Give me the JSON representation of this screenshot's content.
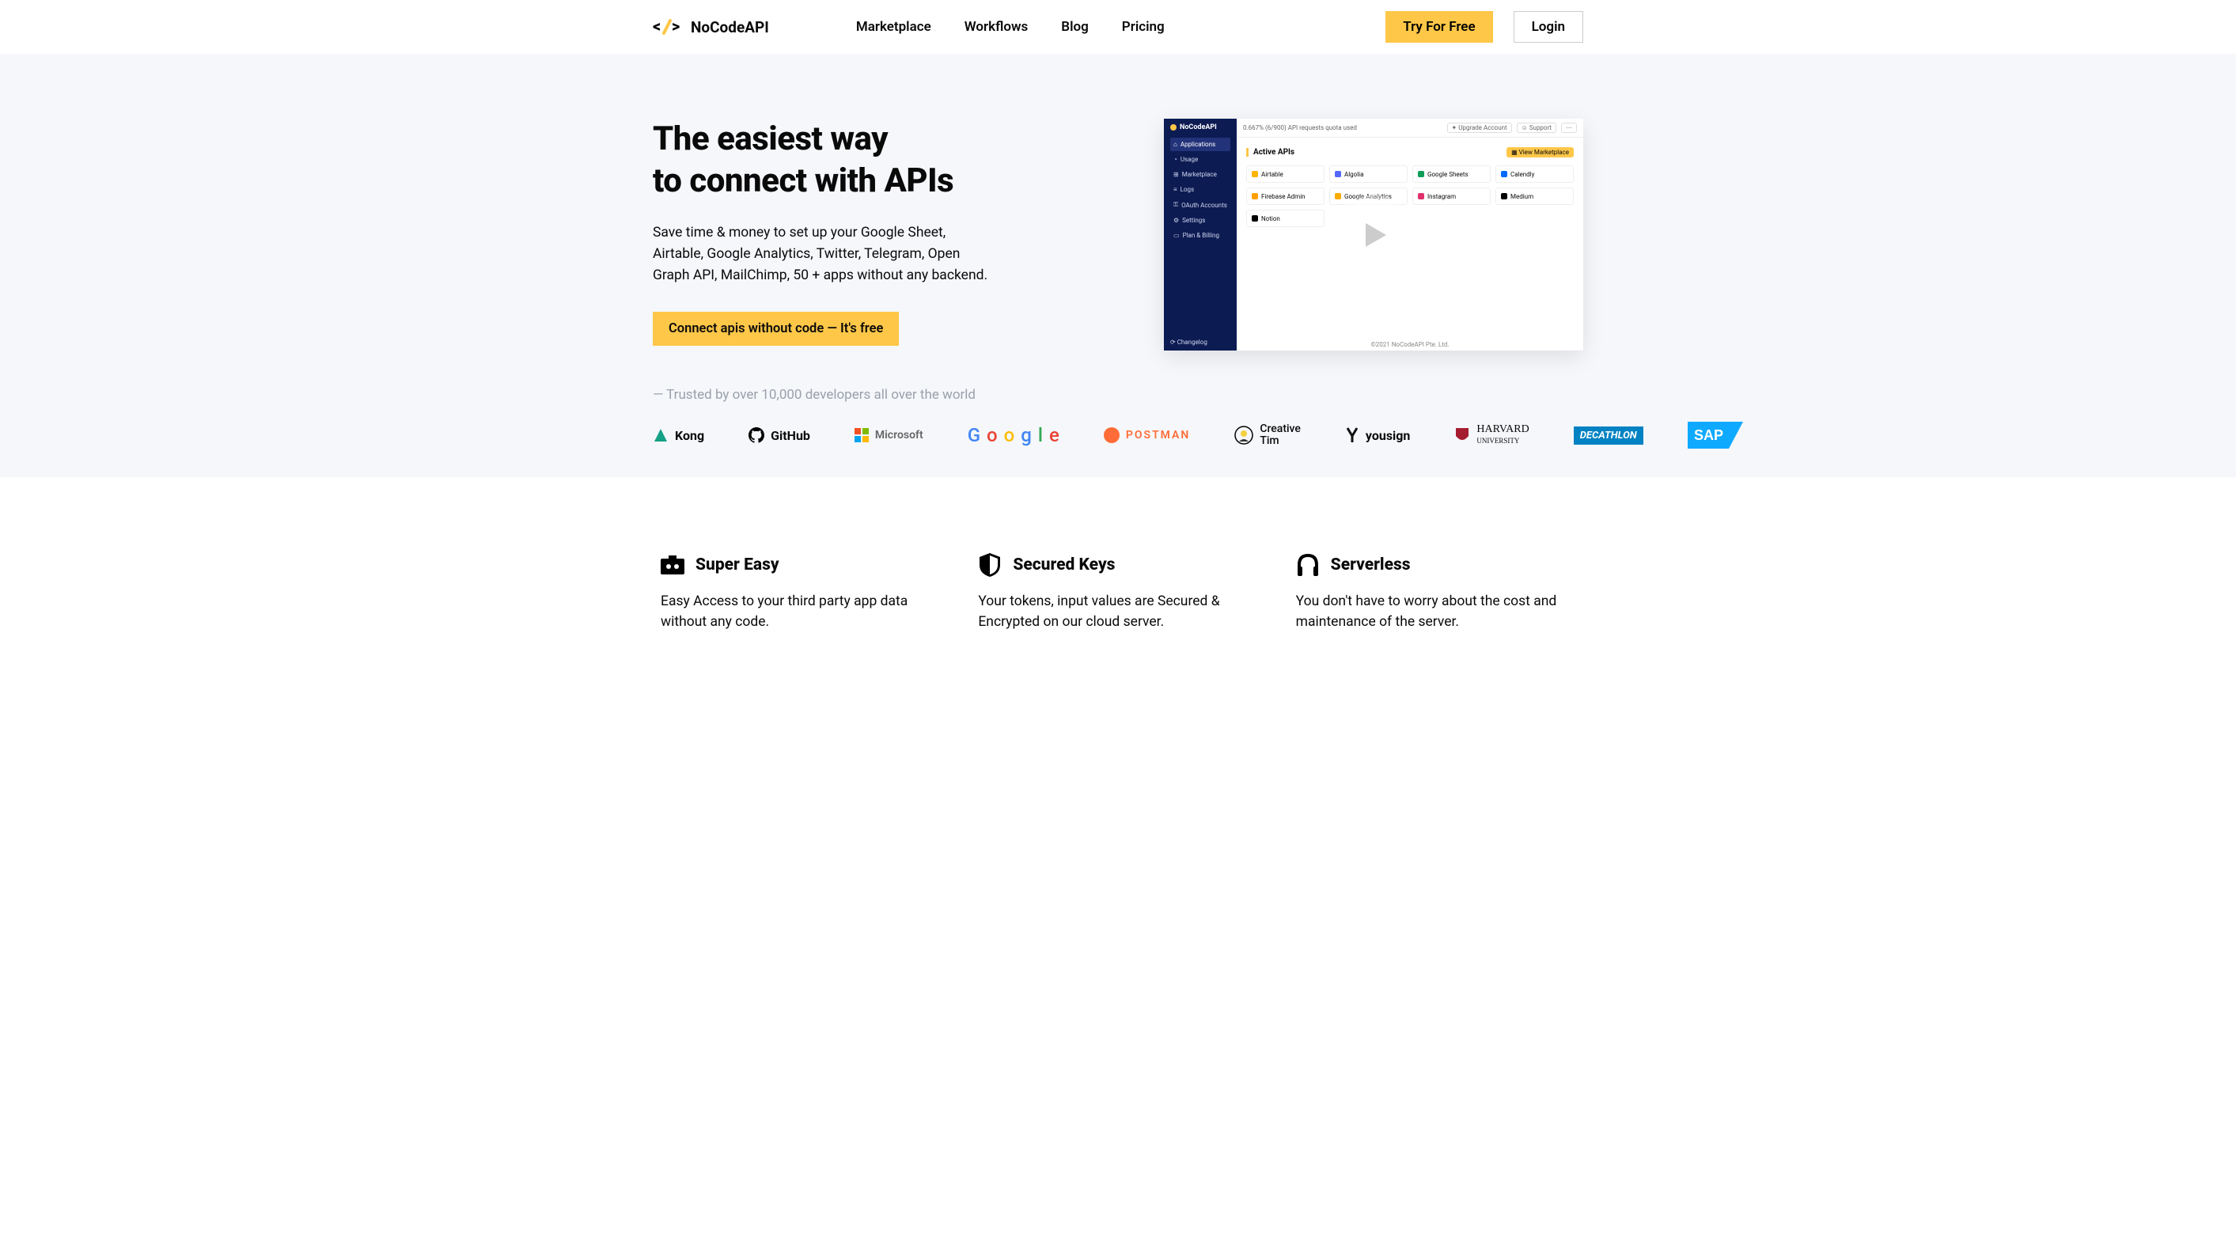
{
  "brand": "NoCodeAPI",
  "nav": {
    "links": [
      "Marketplace",
      "Workflows",
      "Blog",
      "Pricing"
    ],
    "try_free": "Try For Free",
    "login": "Login"
  },
  "hero": {
    "title_l1": "The easiest way",
    "title_l2": "to connect with APIs",
    "subtitle": "Save time & money to set up your Google Sheet, Airtable, Google Analytics, Twitter, Telegram, Open Graph API, MailChimp, 50 + apps without any backend.",
    "cta": "Connect apis without code — It's free"
  },
  "video_mock": {
    "brand": "NoCodeAPI",
    "usage_text": "0.667% (6/900) API requests quota used",
    "upgrade": "Upgrade Account",
    "support": "Support",
    "active_apis": "Active APIs",
    "view_marketplace": "View Marketplace",
    "sidebar": [
      "Applications",
      "Usage",
      "Marketplace",
      "Logs",
      "OAuth Accounts",
      "Settings",
      "Plan & Billing"
    ],
    "changelog": "Changelog",
    "cards": [
      {
        "name": "Airtable",
        "color": "#ffb400"
      },
      {
        "name": "Algolia",
        "color": "#5468ff"
      },
      {
        "name": "Google Sheets",
        "color": "#0f9d58"
      },
      {
        "name": "Calendly",
        "color": "#006bff"
      },
      {
        "name": "Firebase Admin",
        "color": "#ffa000"
      },
      {
        "name": "Google Analytics",
        "color": "#f9ab00"
      },
      {
        "name": "Instagram",
        "color": "#e1306c"
      },
      {
        "name": "Medium",
        "color": "#000"
      },
      {
        "name": "Notion",
        "color": "#000"
      }
    ],
    "footer": "©2021 NoCodeAPI Pte. Ltd."
  },
  "trusted": {
    "text": "— Trusted by over 10,000 developers all over the world",
    "logos": [
      "Kong",
      "GitHub",
      "Microsoft",
      "Google",
      "POSTMAN",
      "Creative Tim",
      "yousign",
      "HARVARD UNIVERSITY",
      "DECATHLON",
      "SAP"
    ]
  },
  "features": [
    {
      "title": "Super Easy",
      "desc": "Easy Access to your third party app data without any code.",
      "icon": "camera"
    },
    {
      "title": "Secured Keys",
      "desc": "Your tokens, input values are Secured & Encrypted on our cloud server.",
      "icon": "shield"
    },
    {
      "title": "Serverless",
      "desc": "You don't have to worry about the cost and maintenance of the server.",
      "icon": "headphones"
    }
  ]
}
